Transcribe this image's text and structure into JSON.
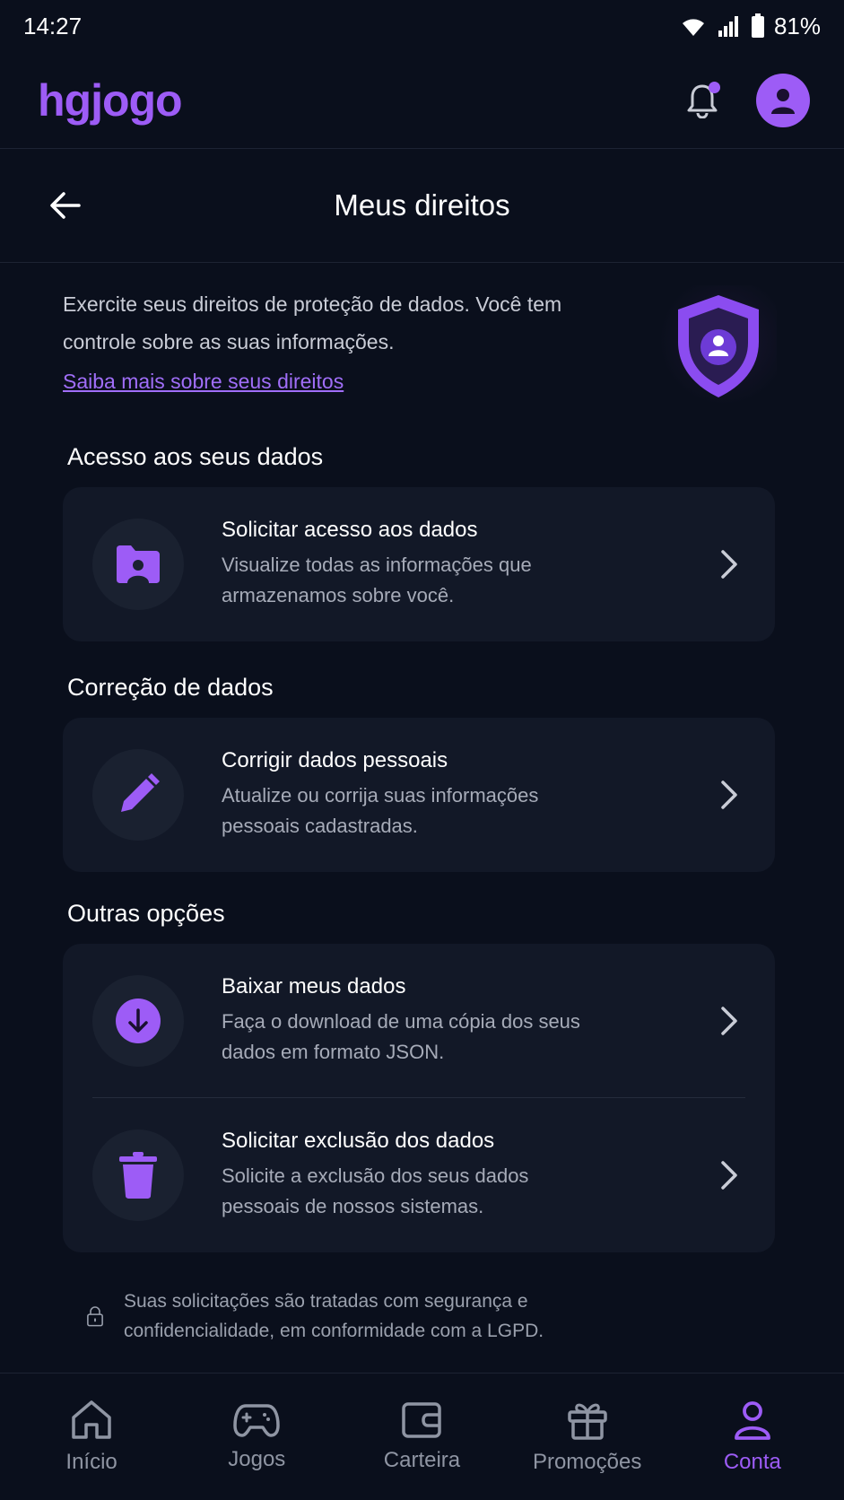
{
  "status": {
    "time": "14:27",
    "battery": "81%"
  },
  "header": {
    "logo": "hgjogo"
  },
  "page": {
    "title": "Meus direitos"
  },
  "intro": {
    "text": "Exercite seus direitos de proteção de dados. Você tem controle sobre as suas informações.",
    "link": "Saiba mais sobre seus direitos"
  },
  "sections": [
    {
      "title": "Acesso aos seus dados",
      "items": [
        {
          "title": "Solicitar acesso aos dados",
          "desc": "Visualize todas as informações que armazenamos sobre você.",
          "icon": "folder-user-icon"
        }
      ]
    },
    {
      "title": "Correção de dados",
      "items": [
        {
          "title": "Corrigir dados pessoais",
          "desc": "Atualize ou corrija suas informações pessoais cadastradas.",
          "icon": "pencil-icon"
        }
      ]
    },
    {
      "title": "Outras opções",
      "items": [
        {
          "title": "Baixar meus dados",
          "desc": "Faça o download de uma cópia dos seus dados em formato JSON.",
          "icon": "download-icon"
        },
        {
          "title": "Solicitar exclusão dos dados",
          "desc": "Solicite a exclusão dos seus dados pessoais de nossos sistemas.",
          "icon": "trash-icon"
        }
      ]
    }
  ],
  "footer": {
    "note": "Suas solicitações são tratadas com segurança e confidencialidade, em conformidade com a LGPD."
  },
  "nav": [
    {
      "label": "Início",
      "icon": "home-icon"
    },
    {
      "label": "Jogos",
      "icon": "gamepad-icon"
    },
    {
      "label": "Carteira",
      "icon": "wallet-icon"
    },
    {
      "label": "Promoções",
      "icon": "gift-icon"
    },
    {
      "label": "Conta",
      "icon": "user-icon",
      "active": true
    }
  ],
  "colors": {
    "accent": "#9d5cf6",
    "background": "#0a0f1c",
    "card": "#121827"
  }
}
